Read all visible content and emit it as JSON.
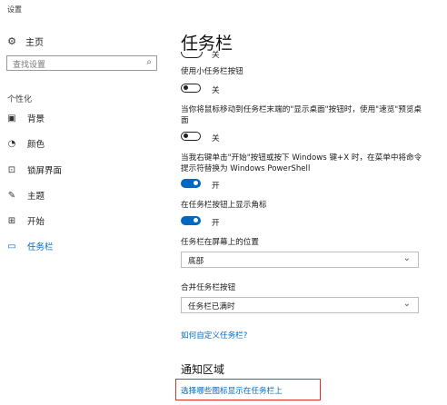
{
  "window": {
    "title": "设置"
  },
  "sidebar": {
    "home_label": "主页",
    "search_placeholder": "查找设置",
    "section_label": "个性化",
    "items": [
      {
        "label": "背景",
        "icon": "image-icon"
      },
      {
        "label": "颜色",
        "icon": "palette-icon"
      },
      {
        "label": "锁屏界面",
        "icon": "lock-screen-icon"
      },
      {
        "label": "主题",
        "icon": "brush-icon"
      },
      {
        "label": "开始",
        "icon": "start-icon"
      },
      {
        "label": "任务栏",
        "icon": "taskbar-icon",
        "active": true
      }
    ]
  },
  "main": {
    "title": "任务栏",
    "partial_toggle_state": "关",
    "settings": [
      {
        "label": "使用小任务栏按钮",
        "state": "关"
      },
      {
        "label": "当你将鼠标移动到任务栏末端的\"显示桌面\"按钮时，使用\"速览\"预览桌面",
        "state": "关"
      },
      {
        "label": "当我右键单击\"开始\"按钮或按下 Windows 键+X 时，在菜单中将命令提示符替换为 Windows PowerShell",
        "state": "开"
      },
      {
        "label": "在任务栏按钮上显示角标",
        "state": "开"
      }
    ],
    "position": {
      "label": "任务栏在屏幕上的位置",
      "value": "底部"
    },
    "combine": {
      "label": "合并任务栏按钮",
      "value": "任务栏已满时"
    },
    "customize_link": "如何自定义任务栏?",
    "notification_area": {
      "heading": "通知区域",
      "link": "选择哪些图标显示在任务栏上"
    }
  },
  "colors": {
    "accent": "#0067c0",
    "highlight": "#e0302c"
  }
}
